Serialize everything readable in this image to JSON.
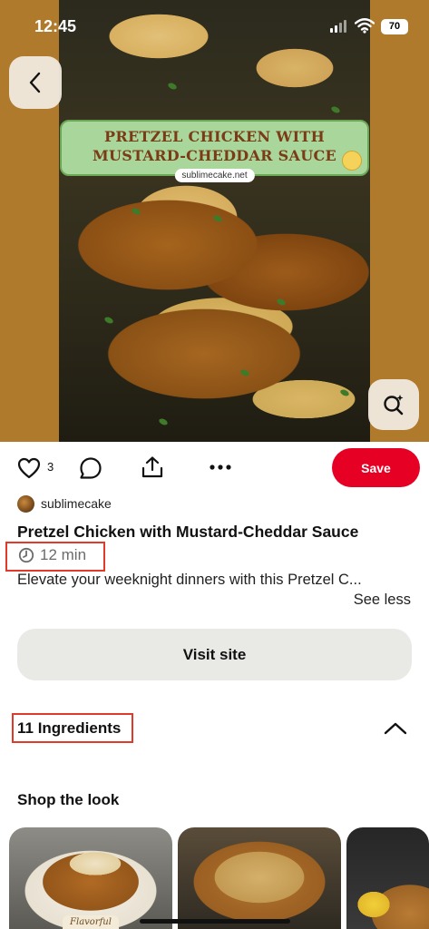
{
  "status_bar": {
    "time": "12:45",
    "battery": "70"
  },
  "hero": {
    "banner_title_line1": "PRETZEL CHICKEN WITH",
    "banner_title_line2": "MUSTARD-CHEDDAR SAUCE",
    "banner_site": "sublimecake.net",
    "back_icon": "chevron-left-icon",
    "visual_search_icon": "visual-search-icon"
  },
  "actions": {
    "like_count": "3",
    "save_label": "Save",
    "icons": [
      "heart-icon",
      "comment-icon",
      "share-icon",
      "more-icon"
    ]
  },
  "pin": {
    "author": "sublimecake",
    "title": "Pretzel Chicken with Mustard-Cheddar Sauce",
    "time": "12 min",
    "description": "Elevate your weeknight dinners with this Pretzel C...",
    "see_less": "See less",
    "visit_site": "Visit site"
  },
  "ingredients": {
    "label": "11 Ingredients"
  },
  "shop": {
    "title": "Shop the look",
    "thumbnail_label": "Flavorful"
  },
  "colors": {
    "save_red": "#e60023",
    "highlight_red": "#e23a2a",
    "hero_bg": "#b07a2c"
  }
}
